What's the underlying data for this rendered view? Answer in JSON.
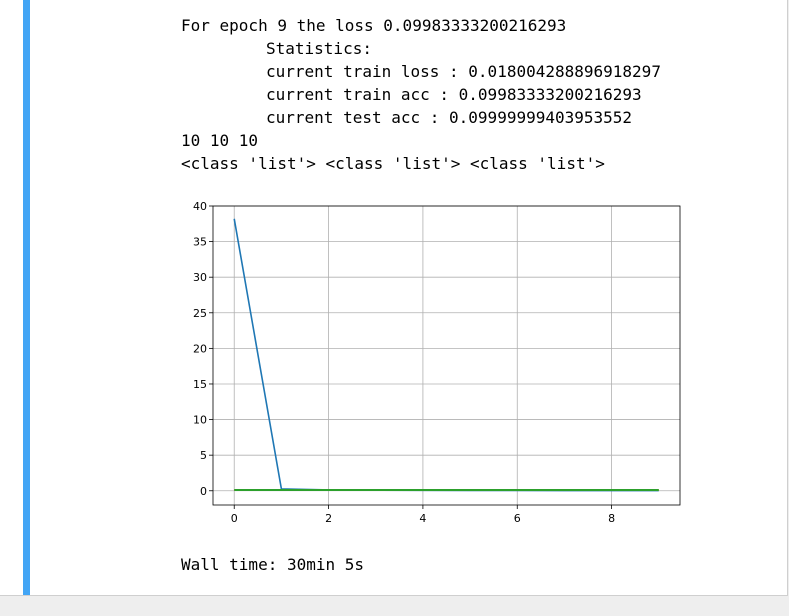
{
  "output": {
    "epoch_line": "For epoch 9 the loss 0.09983333200216293",
    "stats_header": "Statistics:",
    "train_loss_line": "current train loss : 0.018004288896918297",
    "train_acc_line": "current train acc : 0.09983333200216293",
    "test_acc_line": "current test acc : 0.09999999403953552",
    "lens_line": "10 10 10",
    "types_line": "<class 'list'> <class 'list'> <class 'list'>",
    "wall_time_line": "Wall time: 30min 5s"
  },
  "colors": {
    "cell_marker": "#42a5f5",
    "series_1": "#1f77b4",
    "series_2": "#ff7f0e",
    "series_3": "#2ca02c"
  },
  "chart_data": {
    "type": "line",
    "title": "",
    "xlabel": "",
    "ylabel": "",
    "xlim": [
      -0.45,
      9.45
    ],
    "ylim": [
      -2,
      40
    ],
    "grid": true,
    "legend": "none",
    "x": [
      0,
      1,
      2,
      3,
      4,
      5,
      6,
      7,
      8,
      9
    ],
    "x_ticks": [
      0,
      2,
      4,
      6,
      8
    ],
    "y_ticks": [
      0,
      5,
      10,
      15,
      20,
      25,
      30,
      35,
      40
    ],
    "series": [
      {
        "values": [
          38.2,
          0.25,
          0.12,
          0.08,
          0.06,
          0.05,
          0.04,
          0.03,
          0.025,
          0.018
        ],
        "color": "#1f77b4"
      },
      {
        "values": [
          0.1,
          0.1,
          0.1,
          0.1,
          0.1,
          0.1,
          0.1,
          0.1,
          0.1,
          0.1
        ],
        "color": "#ff7f0e"
      },
      {
        "values": [
          0.1,
          0.1,
          0.1,
          0.1,
          0.1,
          0.1,
          0.1,
          0.1,
          0.1,
          0.1
        ],
        "color": "#2ca02c"
      }
    ]
  }
}
